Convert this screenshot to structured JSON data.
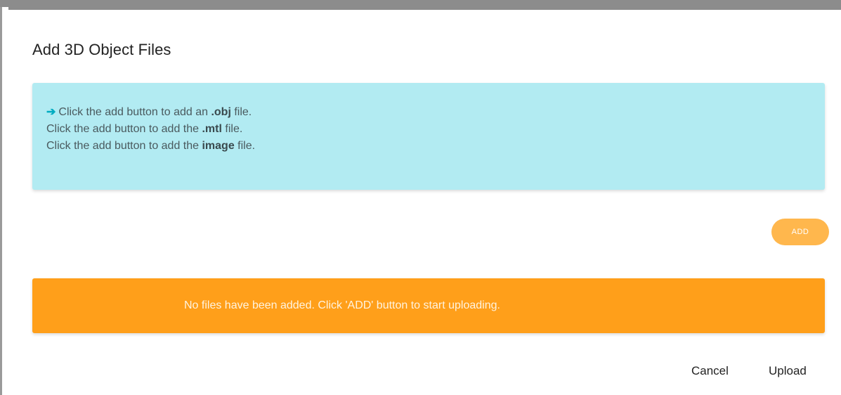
{
  "dialog": {
    "title": "Add 3D Object Files"
  },
  "instructions": {
    "arrow_icon": "arrow-right-icon",
    "line1": {
      "pre": "Click the add button to add an ",
      "bold": ".obj",
      "post": " file."
    },
    "line2": {
      "pre": "Click the add button to add the ",
      "bold": ".mtl",
      "post": " file."
    },
    "line3": {
      "pre": "Click the add button to add the ",
      "bold": "image",
      "post": " file."
    },
    "background_color": "#b2ebf2",
    "arrow_color": "#00acc1"
  },
  "add_button": {
    "label": "ADD",
    "color": "#ffb74d"
  },
  "notice": {
    "text": "No files have been added. Click 'ADD' button to start uploading.",
    "color": "#ff9f1a"
  },
  "footer": {
    "cancel_label": "Cancel",
    "upload_label": "Upload"
  }
}
